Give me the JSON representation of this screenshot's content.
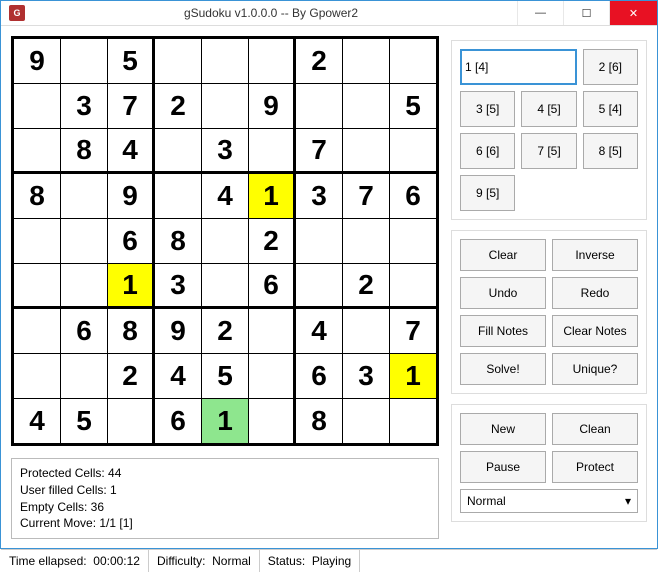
{
  "window": {
    "title": "gSudoku v1.0.0.0 -- By Gpower2"
  },
  "board": [
    [
      "9",
      "",
      "5",
      "",
      "",
      "",
      "2",
      "",
      ""
    ],
    [
      "",
      "3",
      "7",
      "2",
      "",
      "9",
      "",
      "",
      "5"
    ],
    [
      "",
      "8",
      "4",
      "",
      "3",
      "",
      "7",
      "",
      ""
    ],
    [
      "8",
      "",
      "9",
      "",
      "4",
      "1",
      "3",
      "7",
      "6"
    ],
    [
      "",
      "",
      "6",
      "8",
      "",
      "2",
      "",
      "",
      ""
    ],
    [
      "",
      "",
      "1",
      "3",
      "",
      "6",
      "",
      "2",
      ""
    ],
    [
      "",
      "6",
      "8",
      "9",
      "2",
      "",
      "4",
      "",
      "7"
    ],
    [
      "",
      "",
      "2",
      "4",
      "5",
      "",
      "6",
      "3",
      "1"
    ],
    [
      "4",
      "5",
      "",
      "6",
      "1",
      "",
      "8",
      "",
      ""
    ]
  ],
  "highlights": {
    "yellow": [
      [
        3,
        5
      ],
      [
        5,
        2
      ],
      [
        7,
        8
      ]
    ],
    "green": [
      [
        8,
        4
      ]
    ]
  },
  "numpad": [
    {
      "label": "1 [4]",
      "selected": true
    },
    {
      "label": "2 [6]"
    },
    {
      "label": "3 [5]"
    },
    {
      "label": "4 [5]"
    },
    {
      "label": "5 [4]"
    },
    {
      "label": "6 [6]"
    },
    {
      "label": "7 [5]"
    },
    {
      "label": "8 [5]"
    },
    {
      "label": "9 [5]"
    }
  ],
  "actions1": [
    "Clear",
    "Inverse",
    "Undo",
    "Redo",
    "Fill Notes",
    "Clear Notes",
    "Solve!",
    "Unique?"
  ],
  "actions2": [
    "New",
    "Clean",
    "Pause",
    "Protect"
  ],
  "difficulty_selected": "Normal",
  "info": {
    "protected": "Protected Cells: 44",
    "user": "User filled Cells: 1",
    "empty": "Empty Cells: 36",
    "move": "Current Move: 1/1 [1]"
  },
  "status": {
    "time_label": "Time ellapsed:",
    "time_value": "00:00:12",
    "diff_label": "Difficulty:",
    "diff_value": "Normal",
    "status_label": "Status:",
    "status_value": "Playing"
  }
}
